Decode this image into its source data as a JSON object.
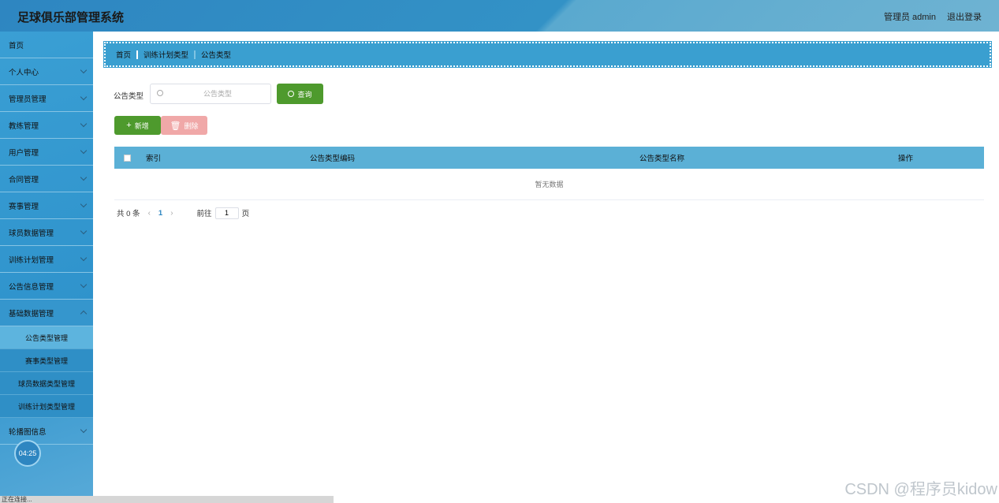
{
  "header": {
    "title": "足球俱乐部管理系统",
    "user": "管理员 admin",
    "logout": "退出登录"
  },
  "sidebar": {
    "items": [
      {
        "label": "首页"
      },
      {
        "label": "个人中心"
      },
      {
        "label": "管理员管理"
      },
      {
        "label": "教练管理"
      },
      {
        "label": "用户管理"
      },
      {
        "label": "合同管理"
      },
      {
        "label": "赛事管理"
      },
      {
        "label": "球员数据管理"
      },
      {
        "label": "训练计划管理"
      },
      {
        "label": "公告信息管理"
      },
      {
        "label": "基础数据管理"
      }
    ],
    "submenu": [
      {
        "label": "公告类型管理"
      },
      {
        "label": "赛事类型管理"
      },
      {
        "label": "球员数据类型管理"
      },
      {
        "label": "训练计划类型管理"
      }
    ],
    "after": {
      "label": "轮播图信息"
    }
  },
  "clock": "04:25",
  "statusbar": "正在连接...",
  "breadcrumb": {
    "home": "首页",
    "level2": "训练计划类型",
    "level3": "公告类型"
  },
  "search": {
    "label": "公告类型",
    "placeholder": "公告类型",
    "query_button": "查询"
  },
  "actions": {
    "add": "新增",
    "delete": "删除"
  },
  "table": {
    "columns": {
      "index": "索引",
      "code": "公告类型编码",
      "name": "公告类型名称",
      "op": "操作"
    },
    "empty": "暂无数据"
  },
  "pager": {
    "total": "共 0 条",
    "current": "1",
    "goto": "前往",
    "page_input": "1",
    "page_suffix": "页"
  },
  "watermark": "CSDN @程序员kidow"
}
